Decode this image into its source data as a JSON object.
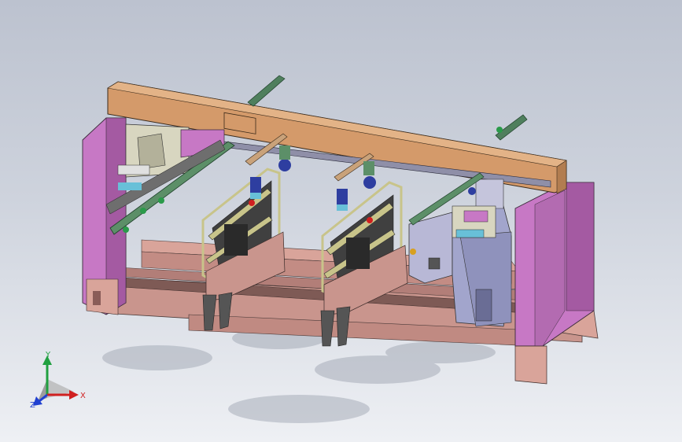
{
  "viewport": {
    "name": "3D model view"
  },
  "colors": {
    "background_top": "#bcc2cf",
    "background_bottom": "#eef0f4",
    "frame_pillar": "#c778c5",
    "beam": "#d49a6a",
    "base_rail": "#d9a49a",
    "rail_green": "#5c8f68",
    "carriage_yellow": "#c8c48a",
    "spindle_housing": "#a2a5cc",
    "motor_dark": "#333333",
    "axis_x": "#d02020",
    "axis_y": "#20a040",
    "axis_z": "#2040d0"
  },
  "triad": {
    "x_label": "X",
    "y_label": "Y",
    "z_label": "Z"
  }
}
